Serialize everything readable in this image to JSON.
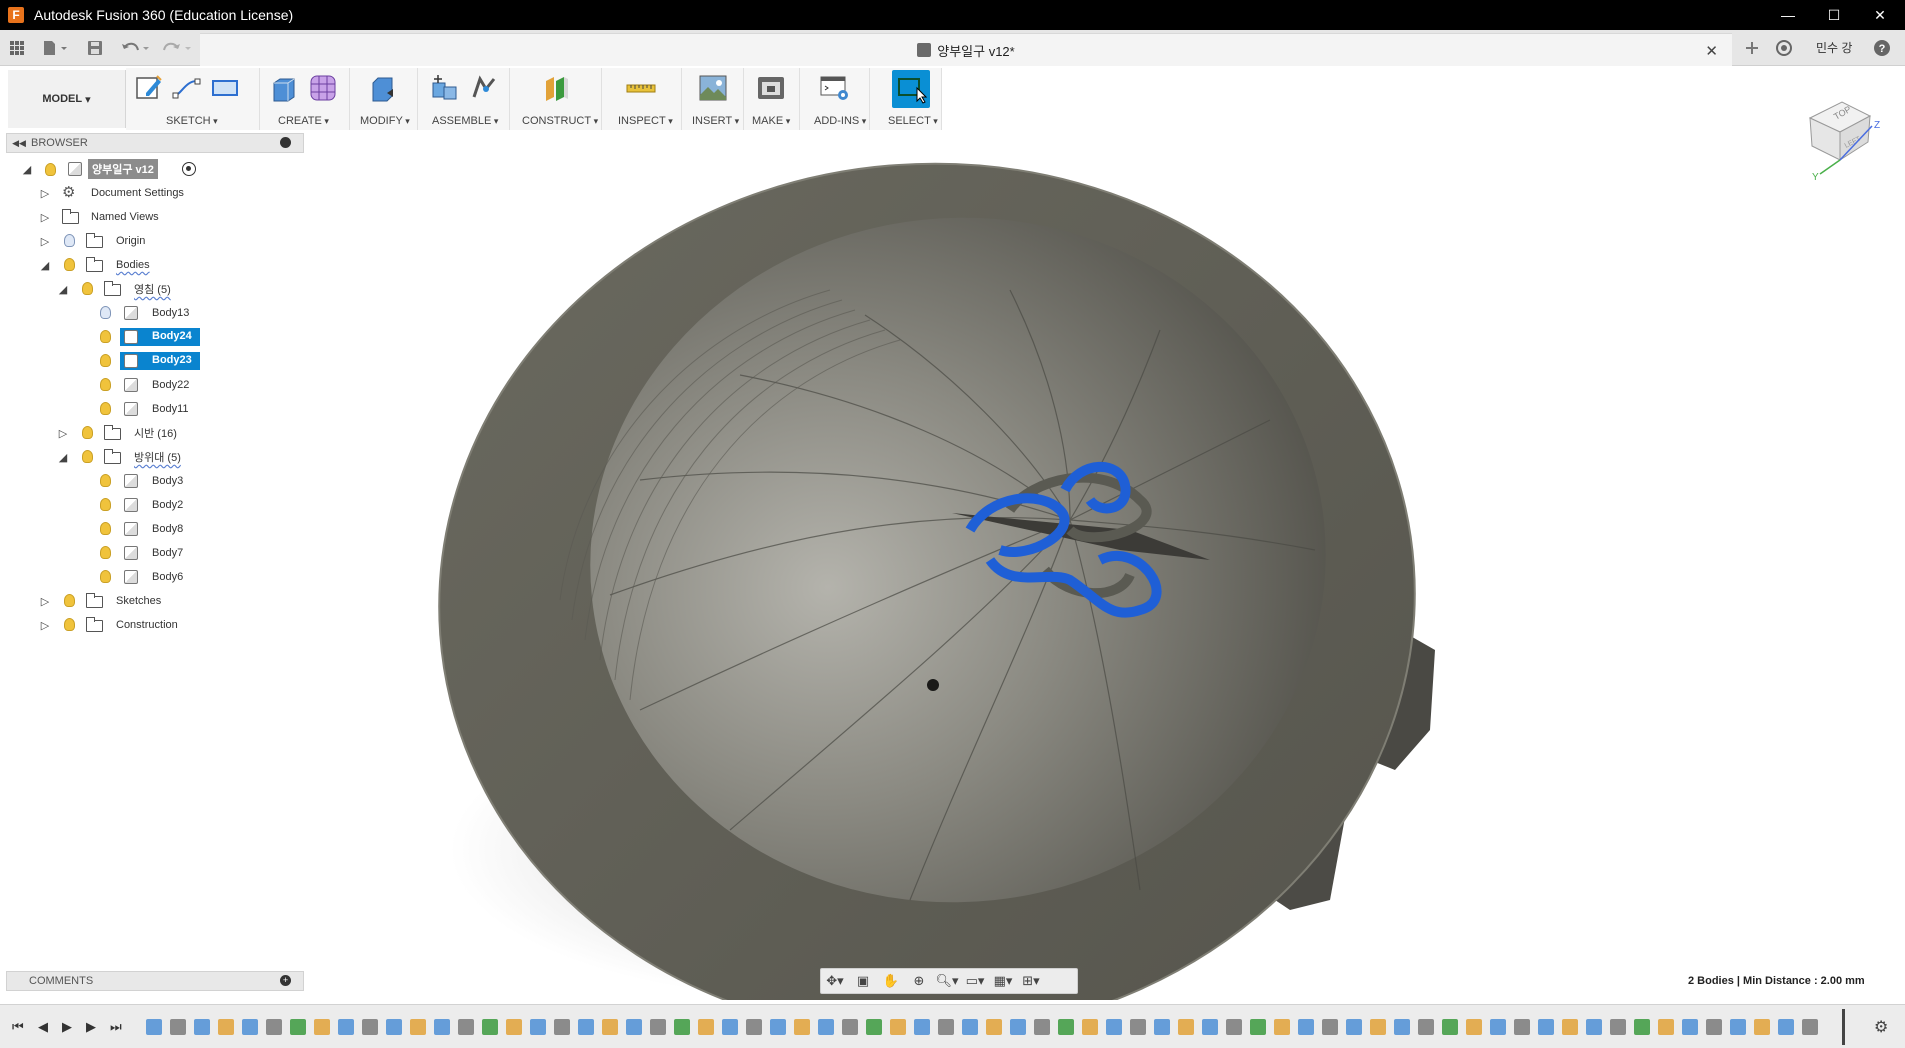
{
  "window": {
    "title": "Autodesk Fusion 360 (Education License)",
    "app_icon": "F",
    "minimize": "—",
    "maximize": "☐",
    "close": "✕"
  },
  "qat": {
    "document_tab": "양부일구 v12*",
    "close_tab": "✕",
    "user_name": "민수 강",
    "help": "?"
  },
  "toolbar": {
    "workspace": "MODEL",
    "groups": [
      "SKETCH",
      "CREATE",
      "MODIFY",
      "ASSEMBLE",
      "CONSTRUCT",
      "INSPECT",
      "INSERT",
      "MAKE",
      "ADD-INS",
      "SELECT"
    ]
  },
  "browser": {
    "header": "BROWSER",
    "root": "양부일구 v12",
    "document_settings": "Document Settings",
    "named_views": "Named Views",
    "origin": "Origin",
    "bodies": "Bodies",
    "folder1": "영침 (5)",
    "folder1_items": [
      "Body13",
      "Body24",
      "Body23",
      "Body22",
      "Body11"
    ],
    "folder2": "시반 (16)",
    "folder3": "방위대 (5)",
    "folder3_items": [
      "Body3",
      "Body2",
      "Body8",
      "Body7",
      "Body6"
    ],
    "sketches": "Sketches",
    "construction": "Construction"
  },
  "comments": {
    "label": "COMMENTS"
  },
  "status": {
    "text": "2 Bodies | Min Distance : 2.00 mm"
  },
  "viewcube": {
    "top": "TOP",
    "left": "LEFT"
  },
  "colors": {
    "accent": "#0a84cf",
    "selection_blue": "#1f5fd6",
    "model_gray": "#5e5d55"
  }
}
